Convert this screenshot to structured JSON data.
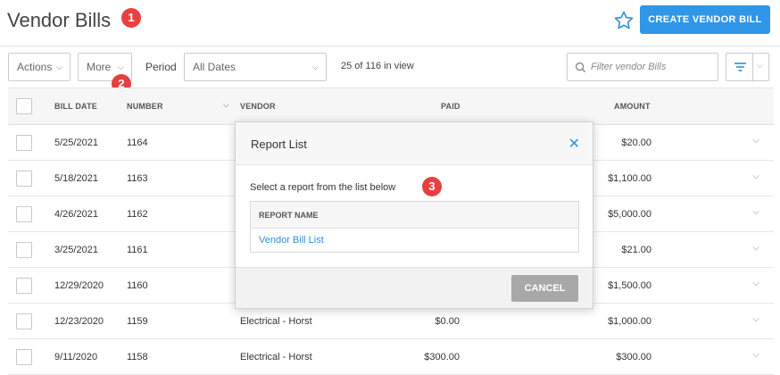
{
  "header": {
    "title": "Vendor Bills",
    "create_button": "CREATE VENDOR BILL"
  },
  "badges": [
    "1",
    "2",
    "3"
  ],
  "toolbar": {
    "actions": "Actions",
    "more": "More",
    "period_label": "Period",
    "period_value": "All Dates",
    "in_view": "25 of 116 in view",
    "filter_placeholder": "Filter vendor Bills"
  },
  "table": {
    "columns": [
      "BILL DATE",
      "NUMBER",
      "VENDOR",
      "PAID",
      "AMOUNT"
    ],
    "rows": [
      {
        "date": "5/25/2021",
        "number": "1164",
        "vendor": "",
        "paid": "",
        "amount": "$20.00"
      },
      {
        "date": "5/18/2021",
        "number": "1163",
        "vendor": "",
        "paid": "",
        "amount": "$1,100.00"
      },
      {
        "date": "4/26/2021",
        "number": "1162",
        "vendor": "",
        "paid": "",
        "amount": "$5,000.00"
      },
      {
        "date": "3/25/2021",
        "number": "1161",
        "vendor": "",
        "paid": "",
        "amount": "$21.00"
      },
      {
        "date": "12/29/2020",
        "number": "1160",
        "vendor": "",
        "paid": "",
        "amount": "$1,500.00"
      },
      {
        "date": "12/23/2020",
        "number": "1159",
        "vendor": "Electrical - Horst",
        "paid": "$0.00",
        "amount": "$1,000.00"
      },
      {
        "date": "9/11/2020",
        "number": "1158",
        "vendor": "Electrical - Horst",
        "paid": "$300.00",
        "amount": "$300.00"
      }
    ]
  },
  "modal": {
    "title": "Report List",
    "close_glyph": "✕",
    "prompt": "Select a report from the list below",
    "column": "REPORT NAME",
    "report": "Vendor Bill List",
    "cancel": "CANCEL"
  },
  "colors": {
    "accent": "#2f96e8",
    "badge": "#e84040",
    "link": "#2f8fd6"
  }
}
